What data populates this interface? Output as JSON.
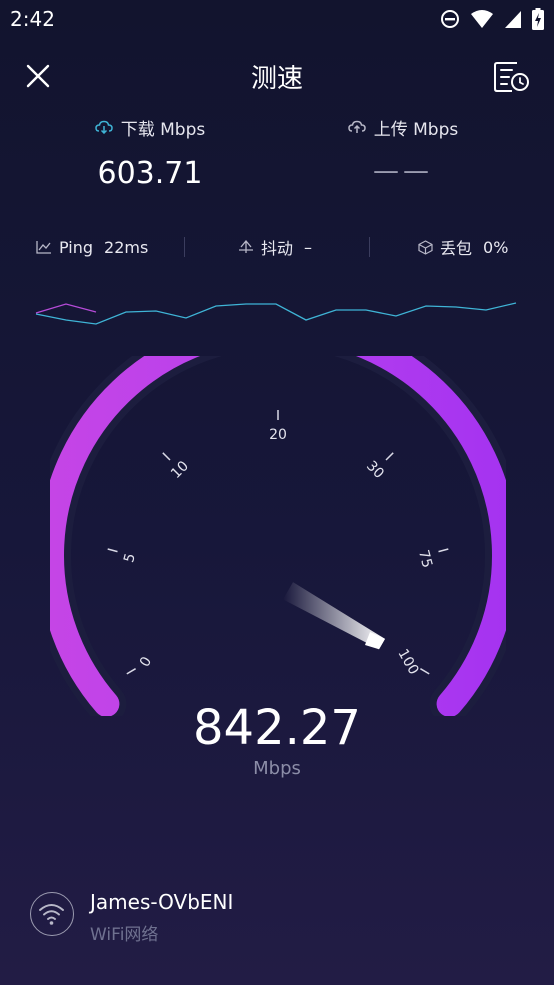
{
  "status_bar": {
    "time": "2:42"
  },
  "header": {
    "title": "测速"
  },
  "download": {
    "label": "下载 Mbps",
    "value": "603.71"
  },
  "upload": {
    "label": "上传 Mbps",
    "value": "——"
  },
  "stats": {
    "ping_label": "Ping",
    "ping_value": "22ms",
    "jitter_label": "抖动",
    "jitter_value": "–",
    "loss_label": "丢包",
    "loss_value": "0%"
  },
  "gauge": {
    "ticks": [
      "0",
      "5",
      "10",
      "20",
      "30",
      "75",
      "100"
    ],
    "arc_color": "#b640ee",
    "needle_value": "100"
  },
  "result": {
    "value": "842.27",
    "unit": "Mbps"
  },
  "network": {
    "name": "James-OVbENI",
    "type": "WiFi网络"
  },
  "colors": {
    "accent": "#b640ee",
    "line_cyan": "#3fb4d6",
    "line_purple": "#b64bd8"
  },
  "icons": [
    "close-icon",
    "history-icon",
    "cloud-download-icon",
    "cloud-upload-icon",
    "ping-chart-icon",
    "jitter-icon",
    "packet-loss-icon",
    "wifi-icon"
  ]
}
